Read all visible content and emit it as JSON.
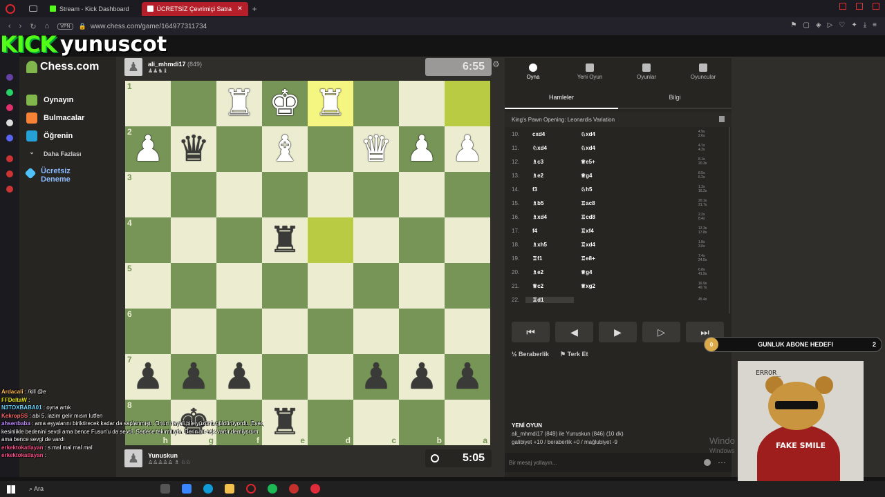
{
  "browser": {
    "tabs": [
      {
        "label": "Stream - Kick Dashboard",
        "active": false
      },
      {
        "label": "ÜCRETSİZ Çevrimiçi Satra",
        "active": true
      }
    ],
    "vpn_label": "VPN",
    "url": "www.chess.com/game/164977311734"
  },
  "stream": {
    "brand": "KICK",
    "username": "yunuscot"
  },
  "sidebar": {
    "logo": "Chess.com",
    "items": [
      {
        "label": "Oynayın",
        "icon": "play-icon"
      },
      {
        "label": "Bulmacalar",
        "icon": "puzzle-icon"
      },
      {
        "label": "Öğrenin",
        "icon": "learn-icon"
      },
      {
        "label": "Daha Fazlası",
        "icon": "chevron-down-icon"
      },
      {
        "label": "Ücretsiz Deneme",
        "icon": "diamond-icon"
      }
    ]
  },
  "top_player": {
    "name": "ali_mhmdi17",
    "rating": "(849)",
    "captured": "♟♟♞♝",
    "clock": "6:55"
  },
  "bottom_player": {
    "name": "Yunuskun",
    "captured": "♙♙♙♙♙ ♗ ♘♘",
    "clock": "5:05"
  },
  "board": {
    "ranks": [
      "1",
      "2",
      "3",
      "4",
      "5",
      "6",
      "7",
      "8"
    ],
    "files": [
      "h",
      "g",
      "f",
      "e",
      "d",
      "c",
      "b",
      "a"
    ],
    "rows": [
      [
        "",
        "",
        "wR",
        "wK",
        "wR",
        "",
        "",
        ""
      ],
      [
        "wP",
        "bQ",
        "",
        "wB",
        "",
        "wQ",
        "wP",
        "wP"
      ],
      [
        "",
        "",
        "",
        "",
        "",
        "",
        "",
        ""
      ],
      [
        "",
        "",
        "",
        "bR",
        "",
        "",
        "",
        ""
      ],
      [
        "",
        "",
        "",
        "",
        "",
        "",
        "",
        ""
      ],
      [
        "",
        "",
        "",
        "",
        "",
        "",
        "",
        ""
      ],
      [
        "bP",
        "bP",
        "bP",
        "",
        "",
        "bP",
        "bP",
        "bP"
      ],
      [
        "",
        "bK",
        "",
        "bR",
        "",
        "",
        "",
        ""
      ]
    ],
    "highlights": [
      [
        0,
        4
      ],
      [
        0,
        7
      ],
      [
        3,
        4
      ]
    ]
  },
  "panel": {
    "tabs": [
      {
        "label": "Oyna",
        "active": true
      },
      {
        "label": "Yeni Oyun",
        "active": false
      },
      {
        "label": "Oyunlar",
        "active": false
      },
      {
        "label": "Oyuncular",
        "active": false
      }
    ],
    "subtabs": [
      {
        "label": "Hamleler",
        "active": true
      },
      {
        "label": "Bilgi",
        "active": false
      }
    ],
    "opening": "King's Pawn Opening: Leonardis Variation",
    "moves": [
      {
        "n": "10.",
        "w": "cxd4",
        "b": "♘xd4",
        "t": [
          "4.9s",
          "2.6s"
        ]
      },
      {
        "n": "11.",
        "w": "♘xd4",
        "b": "♘xd4",
        "t": [
          "4.1s",
          "4.3s"
        ]
      },
      {
        "n": "12.",
        "w": "♗c3",
        "b": "♕e5+",
        "t": [
          "8.1s",
          "20.3s"
        ]
      },
      {
        "n": "13.",
        "w": "♗e2",
        "b": "♕g4",
        "t": [
          "8.5s",
          "6.2s"
        ]
      },
      {
        "n": "14.",
        "w": "f3",
        "b": "♘h5",
        "t": [
          "1.3s",
          "16.2s"
        ]
      },
      {
        "n": "15.",
        "w": "♗b5",
        "b": "♖ac8",
        "t": [
          "20.1s",
          "21.7s"
        ]
      },
      {
        "n": "16.",
        "w": "♗xd4",
        "b": "♖cd8",
        "t": [
          "2.2s",
          "8.4s"
        ]
      },
      {
        "n": "17.",
        "w": "f4",
        "b": "♖xf4",
        "t": [
          "12.3s",
          "17.8s"
        ]
      },
      {
        "n": "18.",
        "w": "♗xh5",
        "b": "♖xd4",
        "t": [
          "1.8s",
          "3.0s"
        ]
      },
      {
        "n": "19.",
        "w": "♖f1",
        "b": "♖e8+",
        "t": [
          "7.4s",
          "24.0s"
        ]
      },
      {
        "n": "20.",
        "w": "♗e2",
        "b": "♕g4",
        "t": [
          "6.8s",
          "41.9s"
        ]
      },
      {
        "n": "21.",
        "w": "♕c2",
        "b": "♕xg2",
        "t": [
          "16.9s",
          "40.7s"
        ]
      },
      {
        "n": "22.",
        "w": "♖d1",
        "b": "",
        "t": [
          "45.4s"
        ]
      }
    ],
    "controls": [
      "⏮",
      "◀",
      "▶",
      "▷",
      "⏭"
    ],
    "draw_label": "Beraberlik",
    "resign_label": "Terk Et",
    "new_game_title": "YENİ OYUN",
    "new_game_line1": "ali_mhmdi17 (849) ile Yunuskun (846) (10 dk)",
    "new_game_line2": "galibiyet +10 / beraberlik +0 / mağlubiyet -9",
    "message_placeholder": "Bir mesaj yollayın..."
  },
  "goal": {
    "current": "0",
    "label": "GUNLUK ABONE HEDEFI",
    "target": "2"
  },
  "webcam": {
    "error_text": "ERROR_",
    "shirt_text": "FAKE SMILE"
  },
  "windows_watermark": {
    "line1": "Windo",
    "line2": "Windows"
  },
  "chat": [
    {
      "user": "Ardacali",
      "text": ": /kill @e",
      "color": "#ffb74d"
    },
    {
      "user": "FFDeltaW",
      "text": ":",
      "color": "#e6e60f"
    },
    {
      "user": "N3TOXBABA01",
      "text": ": oyna artık",
      "color": "#6bd6ff"
    },
    {
      "user": "KekropSS",
      "text": ": abi 5. lazim gelir mısın lutfen",
      "color": "#ff6b6b"
    },
    {
      "user": "ahsenbaba",
      "text": ": ama eşyalarını biriktirecek kadar da saplanmıştı. Onun hayali bile yüzünü güldürüyordu. Evet, kesinlikle bedenini sevdi ama bence Fusun'u da sevdi. Sadece takıntılıydı. Derin bir aşk vardı demiyorum ama bence sevgi de vardı",
      "color": "#c08aff"
    },
    {
      "user": "erkektokatlayan",
      "text": ": s mal mal mal mal",
      "color": "#ff4f8b"
    },
    {
      "user": "erkektokatlayan",
      "text": ":",
      "color": "#ff4f8b"
    }
  ],
  "taskbar": {
    "search_label": "Ara"
  },
  "colors": {
    "board_light": "#ebecd0",
    "board_dark": "#779556",
    "kick_green": "#53fc18",
    "tab_active": "#b51f2a"
  }
}
